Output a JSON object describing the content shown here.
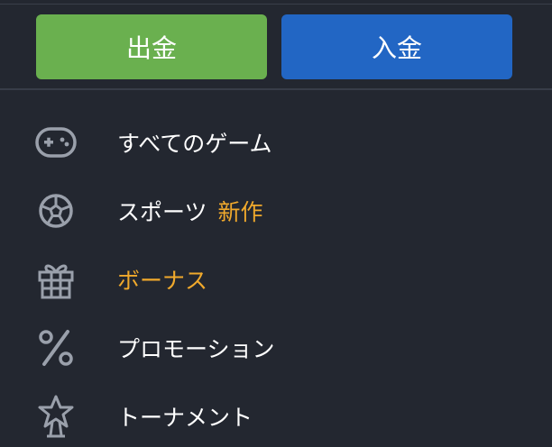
{
  "actions": {
    "withdraw_label": "出金",
    "deposit_label": "入金",
    "withdraw_color": "#6ab04f",
    "deposit_color": "#2266c4"
  },
  "menu": {
    "accent_color": "#f0a92c",
    "items": [
      {
        "label": "すべてのゲーム",
        "icon": "gamepad-icon",
        "badge": ""
      },
      {
        "label": "スポーツ",
        "icon": "soccer-ball-icon",
        "badge": "新作"
      },
      {
        "label": "ボーナス",
        "icon": "gift-icon",
        "badge": "",
        "highlighted": true
      },
      {
        "label": "プロモーション",
        "icon": "percent-icon",
        "badge": ""
      },
      {
        "label": "トーナメント",
        "icon": "trophy-star-icon",
        "badge": ""
      }
    ]
  }
}
